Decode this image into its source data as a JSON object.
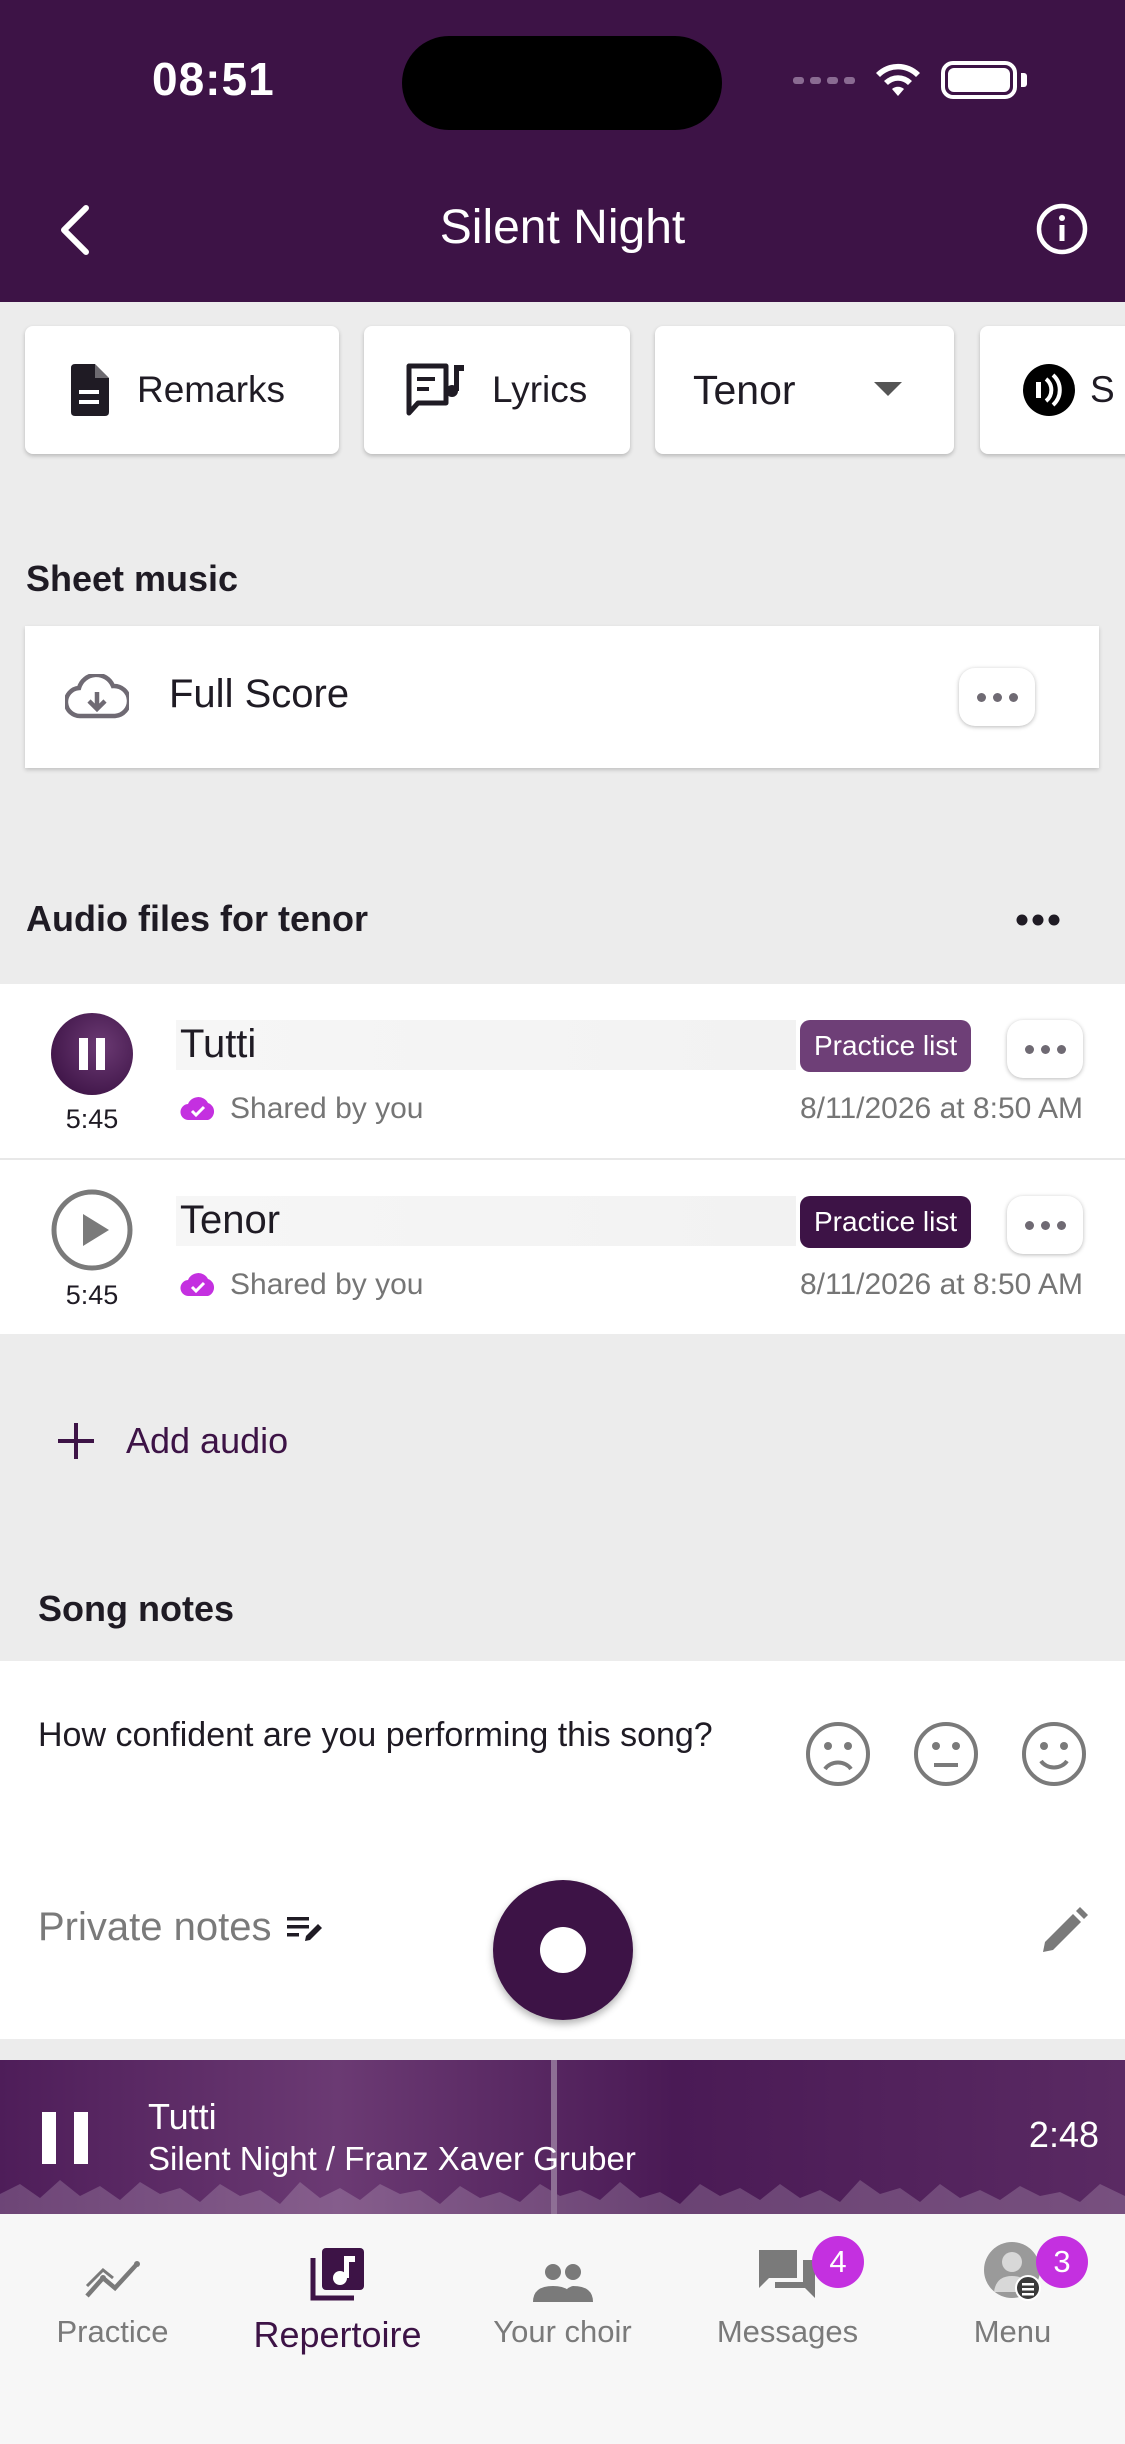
{
  "status_bar": {
    "time": "08:51"
  },
  "header": {
    "title": "Silent Night"
  },
  "chips": {
    "remarks": "Remarks",
    "lyrics": "Lyrics",
    "voice_select": "Tenor",
    "partial_label": "S"
  },
  "sheet_music": {
    "section_title": "Sheet music",
    "item_label": "Full Score"
  },
  "audio": {
    "section_title": "Audio files for tenor",
    "items": [
      {
        "name": "Tutti",
        "badge": "Practice list",
        "duration": "5:45",
        "shared": "Shared by you",
        "date": "8/11/2026 at 8:50 AM",
        "state": "playing"
      },
      {
        "name": "Tenor",
        "badge": "Practice list",
        "duration": "5:45",
        "shared": "Shared by you",
        "date": "8/11/2026 at 8:50 AM",
        "state": "paused"
      }
    ],
    "add_label": "Add audio"
  },
  "song_notes": {
    "section_title": "Song notes",
    "confidence_question": "How confident are you performing this song?",
    "private_notes_label": "Private notes"
  },
  "player": {
    "title": "Tutti",
    "subtitle": "Silent Night / Franz Xaver Gruber",
    "time": "2:48",
    "progress": 0.49
  },
  "tabs": [
    {
      "label": "Practice",
      "icon": "chart-icon"
    },
    {
      "label": "Repertoire",
      "icon": "music-note-icon"
    },
    {
      "label": "Your choir",
      "icon": "people-icon"
    },
    {
      "label": "Messages",
      "icon": "chat-icon",
      "badge": "4"
    },
    {
      "label": "Menu",
      "icon": "avatar",
      "badge": "3"
    }
  ],
  "colors": {
    "brand": "#3d1346",
    "badge": "#c430e0",
    "cloud": "#c430e0"
  }
}
